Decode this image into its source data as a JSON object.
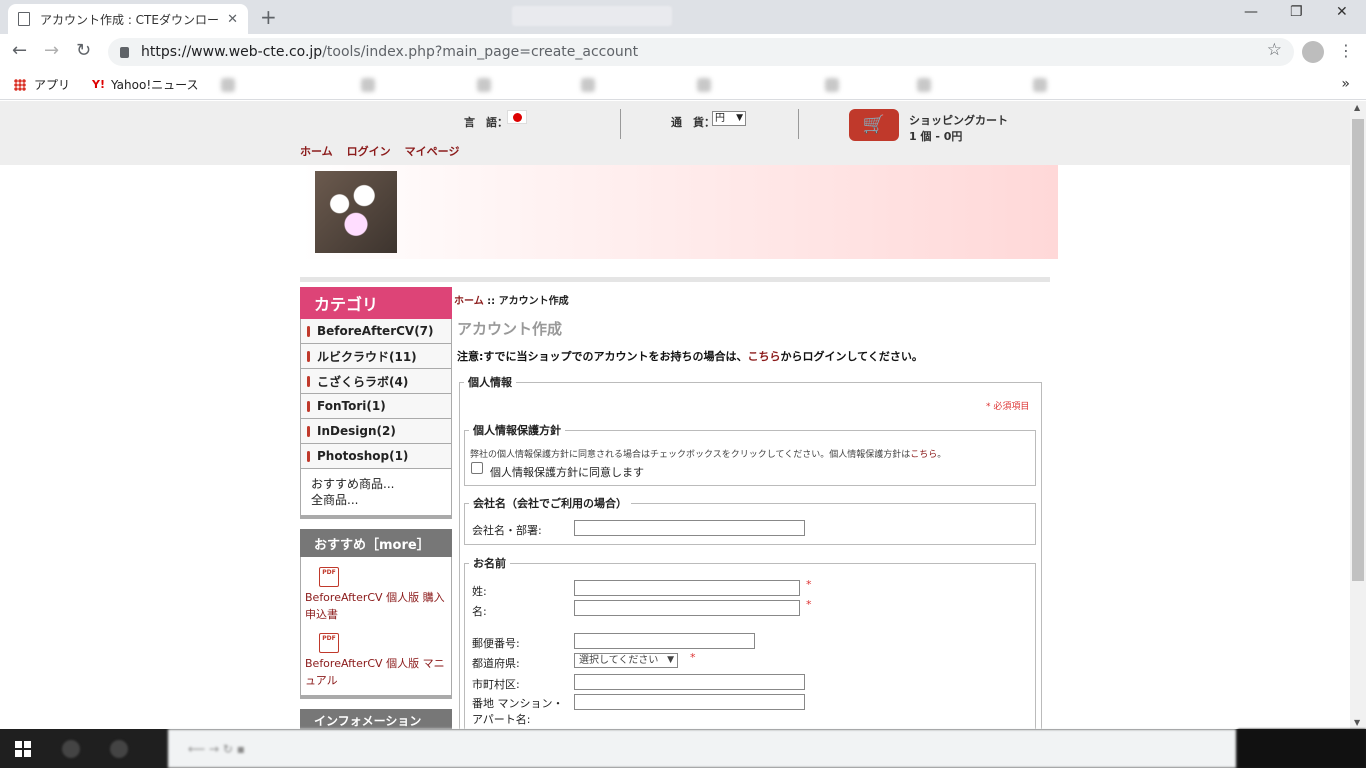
{
  "browser": {
    "tab_title": "アカウント作成 : CTEダウンロードサイト",
    "tab_close": "✕",
    "new_tab": "+",
    "window_min": "—",
    "window_max": "❐",
    "window_close": "✕",
    "back": "←",
    "forward": "→",
    "reload": "↻",
    "url_host": "https://www.web-cte.co.jp",
    "url_path": "/tools/index.php?main_page=create_account",
    "bookmark_star": "☆",
    "menu": "⋮",
    "bookmarks_more": "»",
    "bookmarks": [
      {
        "label": "アプリ"
      },
      {
        "label": "Yahoo!ニュース"
      }
    ]
  },
  "header": {
    "language_label": "言　語：",
    "currency_label": "通　貨：",
    "currency_value": "円",
    "cart_title": "ショッピングカート",
    "cart_count": "1 個 - 0円",
    "nav": [
      "ホーム",
      "ログイン",
      "マイページ"
    ]
  },
  "sidebar": {
    "category_title": "カテゴリ",
    "categories": [
      "BeforeAfterCV(7)",
      "ルビクラウド(11)",
      "こざくらラボ(4)",
      "FonTori(1)",
      "InDesign(2)",
      "Photoshop(1)"
    ],
    "links": [
      "おすすめ商品...",
      "全商品..."
    ],
    "recommend_title": "おすすめ［more］",
    "recommend_items": [
      "BeforeAfterCV 個人版 購入申込書",
      "BeforeAfterCV 個人版 マニュアル"
    ],
    "pdf_label": "PDF",
    "info_title": "インフォメーション"
  },
  "main": {
    "breadcrumb_home": "ホーム",
    "breadcrumb_sep": " :: ",
    "breadcrumb_current": "アカウント作成",
    "title": "アカウント作成",
    "notice_pre": "注意:すでに当ショップでのアカウントをお持ちの場合は、",
    "notice_link": "こちら",
    "notice_post": "からログインしてください。",
    "personal_legend": "個人情報",
    "required_note": "* 必須項目",
    "privacy_legend": "個人情報保護方針",
    "privacy_text": "弊社の個人情報保護方針に同意される場合はチェックボックスをクリックしてください。個人情報保護方針は",
    "privacy_link": "こちら",
    "privacy_text_end": "。",
    "privacy_checkbox_label": "個人情報保護方針に同意します",
    "company_legend": "会社名（会社でご利用の場合）",
    "company_label": "会社名・部署:",
    "name_legend": "お名前",
    "last_name_label": "姓:",
    "first_name_label": "名:",
    "postal_label": "郵便番号:",
    "prefecture_label": "都道府県:",
    "prefecture_select": "選択してください",
    "city_label": "市町村区:",
    "address_label_1": "番地 マンション・",
    "address_label_2": "アパート名:",
    "required_mark": "*"
  }
}
